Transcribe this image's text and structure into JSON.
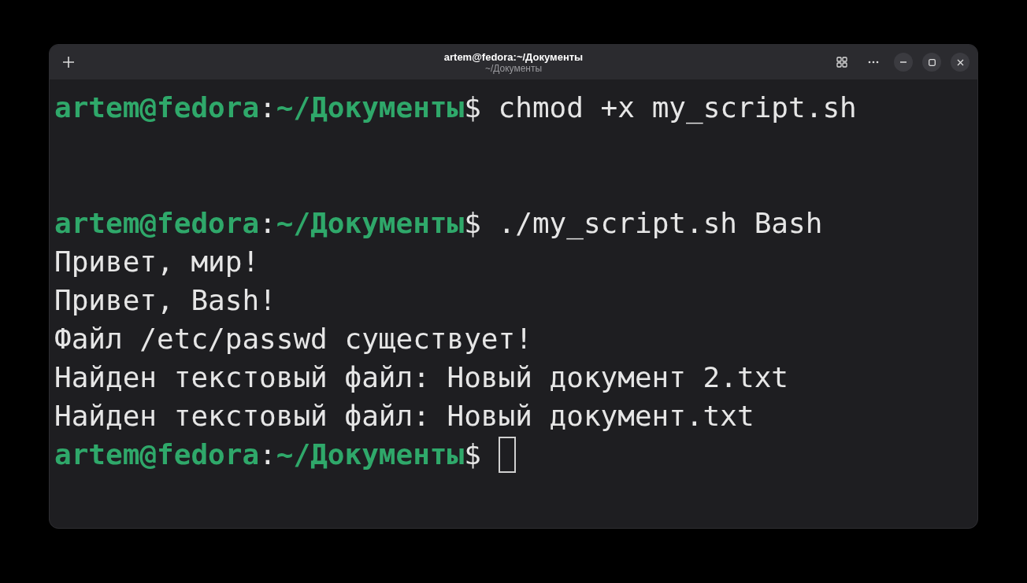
{
  "window": {
    "title": "artem@fedora:~/Документы",
    "subtitle": "~/Документы"
  },
  "terminal": {
    "lines": [
      {
        "kind": "prompt",
        "user": "artem@fedora",
        "separator": ":",
        "path": "~/Документы",
        "symbol": "$",
        "command": "chmod +x my_script.sh",
        "cursor": false
      },
      {
        "kind": "blank"
      },
      {
        "kind": "blank"
      },
      {
        "kind": "prompt",
        "user": "artem@fedora",
        "separator": ":",
        "path": "~/Документы",
        "symbol": "$",
        "command": "./my_script.sh Bash",
        "cursor": false
      },
      {
        "kind": "output",
        "text": "Привет, мир!"
      },
      {
        "kind": "output",
        "text": "Привет, Bash!"
      },
      {
        "kind": "output",
        "text": "Файл /etc/passwd существует!"
      },
      {
        "kind": "output",
        "text": "Найден текстовый файл: Новый документ 2.txt"
      },
      {
        "kind": "output",
        "text": "Найден текстовый файл: Новый документ.txt"
      },
      {
        "kind": "prompt",
        "user": "artem@fedora",
        "separator": ":",
        "path": "~/Документы",
        "symbol": "$",
        "cursor": true
      }
    ]
  }
}
